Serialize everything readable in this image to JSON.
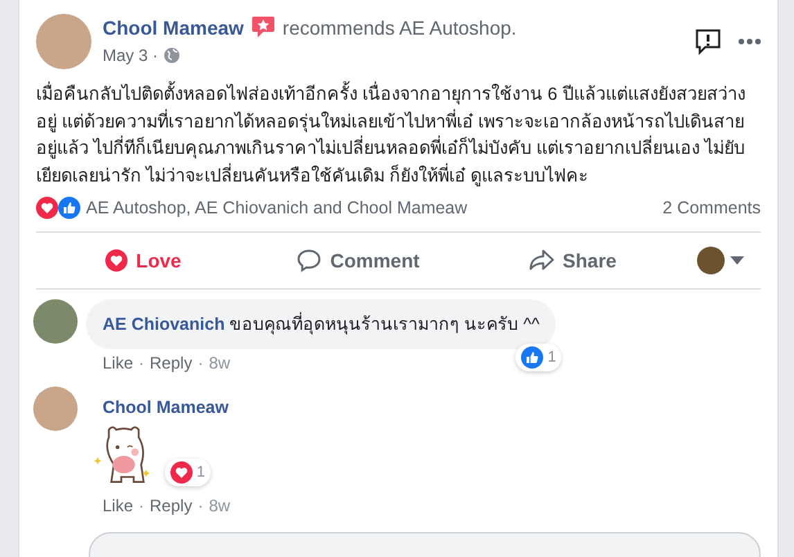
{
  "post": {
    "author": "Chool Mameaw",
    "action": "recommends AE Autoshop.",
    "date": "May 3 ·",
    "text": "เมื่อคืนกลับไปติดตั้งหลอดไฟส่องเท้าอีกครั้ง เนื่องจากอายุการใช้งาน 6 ปีแล้วแต่แสงยังสวยสว่างอยู่ แต่ด้วยความที่เราอยากได้หลอดรุ่นใหม่เลยเข้าไปหาพี่เอ๋ เพราะจะเอากล้องหน้ารถไปเดินสายอยู่แล้ว ไปกี่ทีก็เนียบคุณภาพเกินราคาไม่เปลี่ยนหลอดพี่เอ๋ก็ไม่บังคับ แต่เราอยากเปลี่ยนเอง ไม่ยับเยียดเลยน่ารัก ไม่ว่าจะเปลี่ยนคันหรือใช้คันเดิม ก็ยังให้พี่เอ๋ ดูแลระบบไฟคะ"
  },
  "reactions": {
    "names": "AE Autoshop, AE Chiovanich and Chool Mameaw",
    "comments_count": "2 Comments"
  },
  "actions": [
    {
      "kind": "love",
      "label": "Love",
      "selected": true
    },
    {
      "kind": "comment",
      "label": "Comment",
      "selected": false
    },
    {
      "kind": "share",
      "label": "Share",
      "selected": false
    }
  ],
  "comments": [
    {
      "kind": "text",
      "author": "AE Chiovanich",
      "text": "ขอบคุณที่อุดหนุนร้านเรามากๆ นะครับ ^^",
      "reaction": {
        "kind": "like",
        "count": "1"
      },
      "links": [
        "Like",
        "·",
        "Reply",
        "·"
      ],
      "time": "8w"
    },
    {
      "kind": "sticker",
      "author": "Chool Mameaw",
      "reaction": {
        "kind": "love",
        "count": "1"
      },
      "links": [
        "Like",
        "·",
        "Reply",
        "·"
      ],
      "time": "8w"
    }
  ]
}
